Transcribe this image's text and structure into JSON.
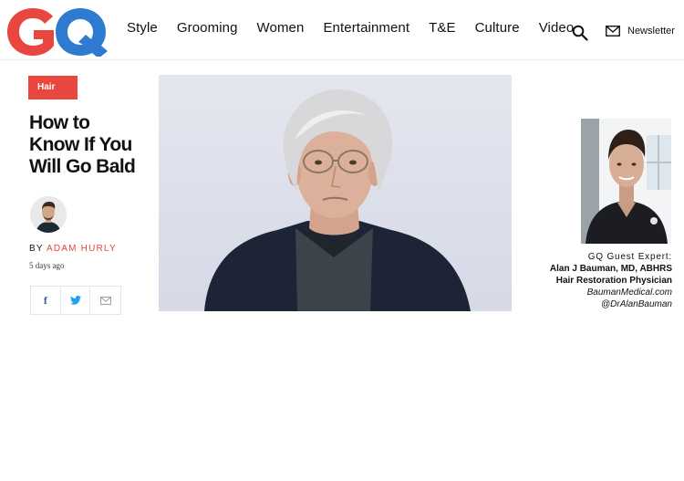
{
  "header": {
    "logo_text": "GQ",
    "nav": [
      "Style",
      "Grooming",
      "Women",
      "Entertainment",
      "T&E",
      "Culture",
      "Video"
    ],
    "newsletter_label": "Newsletter",
    "search_icon": "search-icon",
    "newsletter_icon": "mail-icon"
  },
  "article": {
    "tag": "Hair",
    "headline_lines": [
      "How to",
      "Know If You",
      "Will Go Bald"
    ],
    "by_prefix": "BY",
    "author": "ADAM HURLY",
    "posted": "5 days ago",
    "share": {
      "facebook_label": "f",
      "twitter_icon": "twitter-icon",
      "email_icon": "email-icon"
    }
  },
  "expert": {
    "label": "GQ Guest Expert:",
    "name": "Alan J Bauman, MD, ABHRS",
    "title": "Hair Restoration Physician",
    "website": "BaumanMedical.com",
    "handle": "@DrAlanBauman"
  },
  "colors": {
    "accent": "#e9463f",
    "logo_red": "#e9463f",
    "logo_blue": "#2f7bd0",
    "facebook": "#3b5998",
    "twitter": "#1da1f2"
  }
}
